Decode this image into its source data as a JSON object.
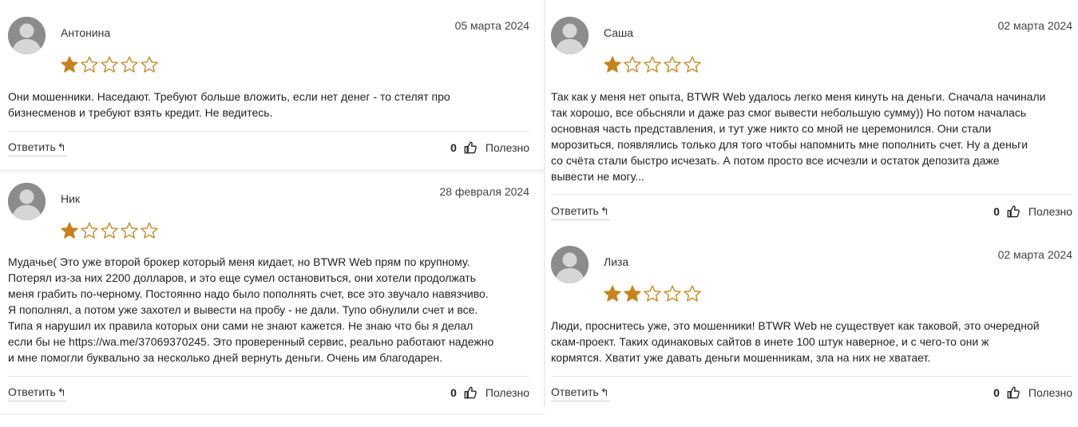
{
  "colors": {
    "star_filled": "#c8821b",
    "star_empty": "#c8821b",
    "avatar": "#8c8c8c"
  },
  "icons": {
    "avatar": "user-avatar-icon",
    "star": "star-icon",
    "reply": "reply-arrow-icon",
    "like": "thumbs-up-icon"
  },
  "labels": {
    "reply": "Ответить",
    "reply_arrow": "↰",
    "useful": "Полезно"
  },
  "reviews": [
    {
      "name": "Антонина",
      "date": "05 марта 2024",
      "rating": 1,
      "lines": [
        "Они мошенники. Наседают. Требуют больше вложить, если нет денег - то стелят про",
        "бизнесменов и требуют взять кредит. Не ведитесь."
      ],
      "likes": "0"
    },
    {
      "name": "Ник",
      "date": "28 февраля 2024",
      "rating": 1,
      "lines": [
        "Мудачье( Это уже второй брокер который меня кидает, но BTWR Web прям по крупному.",
        "Потерял из-за них 2200 долларов, и это еще сумел остановиться, они хотели продолжать",
        "меня грабить по-черному. Постоянно надо было пополнять счет, все это звучало навязчиво.",
        "Я пополнял, а потом уже захотел и вывести на пробу - не дали. Тупо обнулили счет и все.",
        "Типа я нарушил их правила которых они сами не знают кажется. Не знаю что бы я делал",
        "если бы не https://wa.me/37069370245. Это проверенный сервис, реально работают надежно",
        "и мне помогли буквально за несколько дней вернуть деньги. Очень им благодарен."
      ],
      "likes": "0"
    },
    {
      "name": "Саша",
      "date": "02 марта 2024",
      "rating": 1,
      "lines": [
        "Так как у меня нет опыта, BTWR Web удалось легко меня кинуть на деньги. Сначала начинали",
        "так хорошо, все обьсняли и даже раз смог вывести небольшую сумму)) Но потом началась",
        "основная часть представления, и тут уже никто со мной не церемонился. Они стали",
        "морозиться, появлялись только для того чтобы напомнить мне пополнить счет. Ну а деньги",
        "со счёта стали быстро исчезать. А потом просто все исчезли и остаток депозита даже",
        "вывести не могу..."
      ],
      "likes": "0"
    },
    {
      "name": "Лиза",
      "date": "02 марта 2024",
      "rating": 2,
      "lines": [
        "Люди, проснитесь уже, это мошенники! BTWR Web не существует как таковой, это очередной",
        "скам-проект. Таких одинаковых сайтов в инете 100 штук наверное, и с чего-то они ж",
        "кормятся. Хватит уже давать деньги мошенникам, зла на них не хватает."
      ],
      "likes": "0"
    }
  ]
}
